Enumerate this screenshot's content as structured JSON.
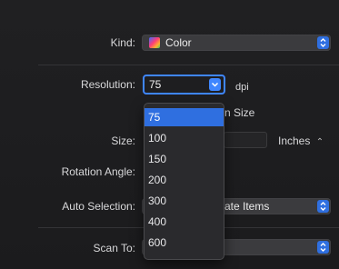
{
  "form": {
    "kind": {
      "label": "Kind:",
      "value": "Color",
      "icon": "color-swatch-icon"
    },
    "resolution": {
      "label": "Resolution:",
      "value": "75",
      "unit": "dpi",
      "partial_checkbox_label": "n Size"
    },
    "size": {
      "label": "Size:",
      "unit": "Inches",
      "unit_icon": "up-down-chevron-icon"
    },
    "rotation": {
      "label": "Rotation Angle:"
    },
    "auto_selection": {
      "label": "Auto Selection:",
      "value_partial": "ate Items"
    },
    "scan_to": {
      "label": "Scan To:"
    }
  },
  "resolution_menu": {
    "items": [
      "75",
      "100",
      "150",
      "200",
      "300",
      "400",
      "600"
    ],
    "selected_index": 0
  },
  "colors": {
    "accent": "#2f6fe0",
    "focus_ring": "#3f86ff",
    "background": "#1c1c1e",
    "menu_bg": "#2a2a2d"
  }
}
